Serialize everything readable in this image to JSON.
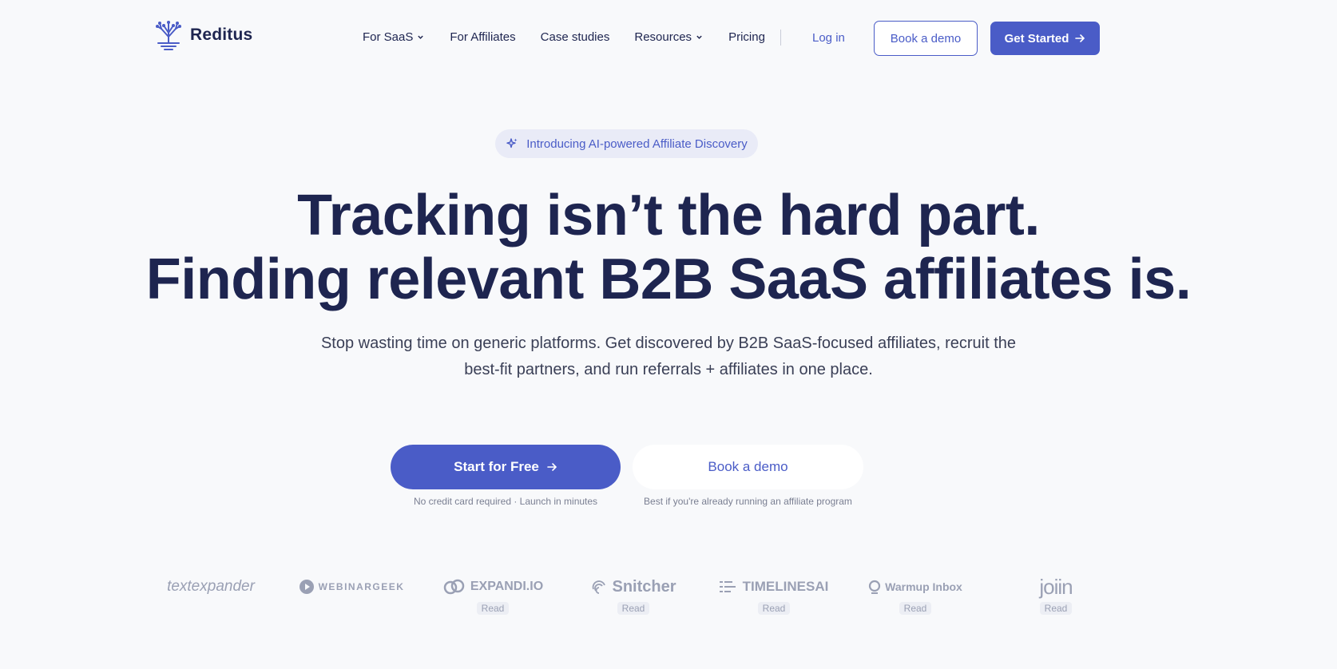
{
  "brand": {
    "name": "Reditus"
  },
  "nav": {
    "items": [
      {
        "label": "For SaaS",
        "dropdown": true
      },
      {
        "label": "For Affiliates",
        "dropdown": false
      },
      {
        "label": "Case studies",
        "dropdown": false
      },
      {
        "label": "Resources",
        "dropdown": true
      },
      {
        "label": "Pricing",
        "dropdown": false
      }
    ],
    "login": "Log in",
    "book_demo": "Book a demo",
    "get_started": "Get Started"
  },
  "hero": {
    "pill": "Introducing AI-powered Affiliate Discovery",
    "headline_line1": "Tracking isn’t the hard part.",
    "headline_line2": "Finding relevant B2B SaaS affiliates is.",
    "subtitle_line1": "Stop wasting time on generic platforms. Get discovered by B2B SaaS-focused affiliates, recruit the",
    "subtitle_line2": "best-fit partners, and run referrals + affiliates in one place.",
    "cta_primary": "Start for Free",
    "cta_primary_note": "No credit card required · Launch in minutes",
    "cta_secondary": "Book a demo",
    "cta_secondary_note": "Best if you're already running an affiliate program"
  },
  "logos": [
    {
      "name": "textexpander",
      "read": ""
    },
    {
      "name": "WEBINARGEEK",
      "read": ""
    },
    {
      "name": "EXPANDI.IO",
      "read": "Read"
    },
    {
      "name": "Snitcher",
      "read": "Read"
    },
    {
      "name": "TIMELINESAI",
      "read": "Read"
    },
    {
      "name": "Warmup Inbox",
      "read": "Read"
    },
    {
      "name": "joiin",
      "read": "Read"
    }
  ],
  "colors": {
    "accent": "#4a5cc7",
    "heading": "#1e2550",
    "background": "#f8f9fb"
  }
}
